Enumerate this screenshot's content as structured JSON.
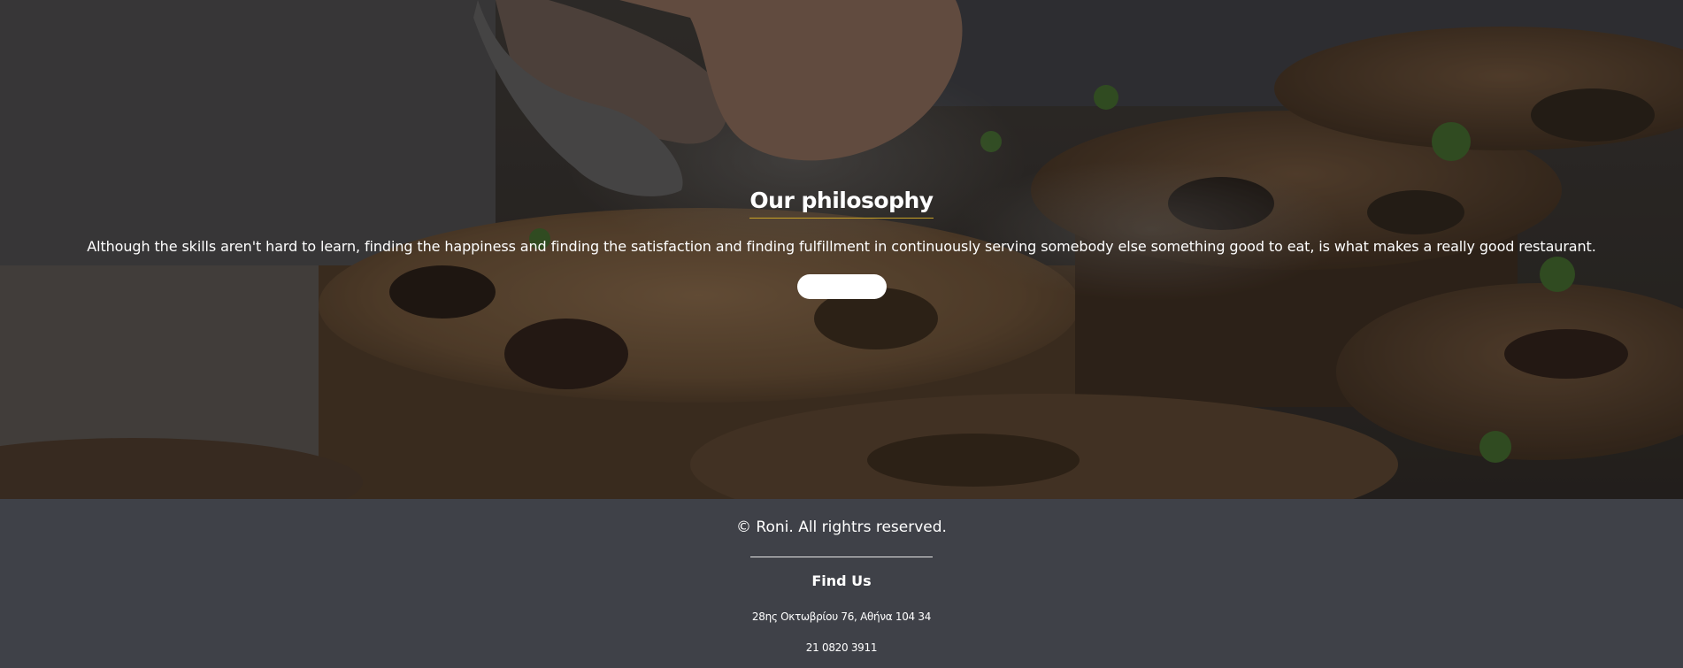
{
  "hero": {
    "title": "Our philosophy",
    "text": "Although the skills aren't hard to learn, finding the happiness and finding the satisfaction and finding fulfillment in continuously serving somebody else something good to eat, is what makes a really good restaurant.",
    "button_label": "",
    "background_image": "chef-plating-food-on-wooden-boards",
    "accent_color": "#c9a227"
  },
  "footer": {
    "copyright": "© Roni. All rightrs reserved.",
    "find_us_title": "Find Us",
    "address": "28ης Οκτωβρίου 76, Αθήνα 104 34",
    "phone": "21 0820 3911",
    "background_color": "#3f4148"
  }
}
